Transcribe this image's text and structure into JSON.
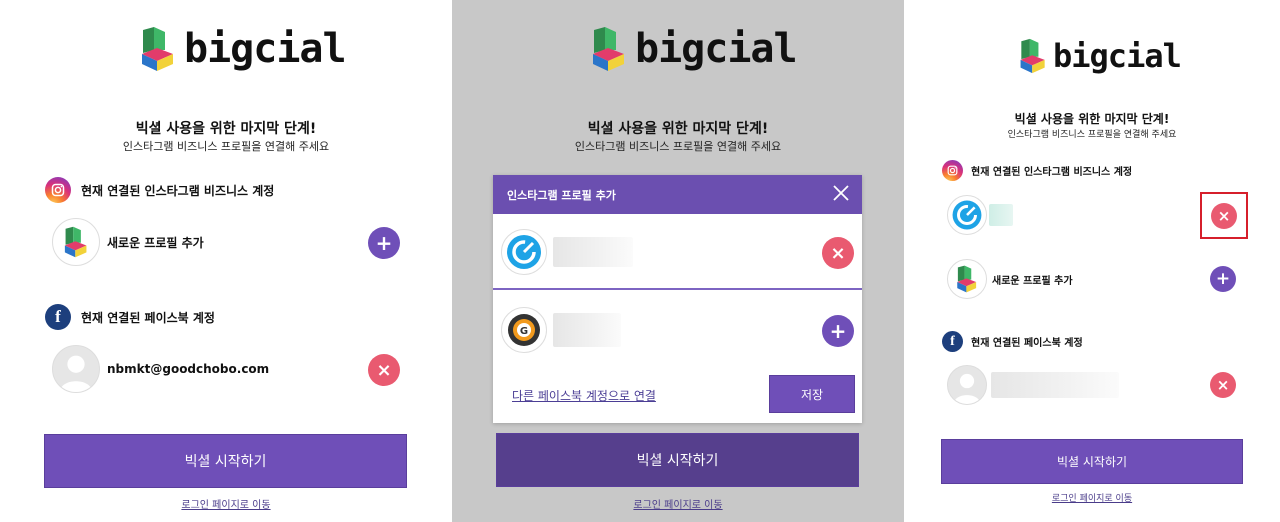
{
  "brand": {
    "name": "bigcial"
  },
  "setup": {
    "heading": "빅셜 사용을 위한 마지막 단계!",
    "subheading": "인스타그램 비즈니스 프로필을 연결해 주세요"
  },
  "instagram_section": {
    "title": "현재 연결된 인스타그램 비즈니스 계정"
  },
  "facebook_section": {
    "title": "현재 연결된 페이스북 계정"
  },
  "add_profile_label": "새로운 프로필 추가",
  "facebook_account_email": "nbmkt@goodchobo.com",
  "start_button": "빅셜 시작하기",
  "login_link": "로그인 페이지로 이동",
  "modal": {
    "title": "인스타그램 프로필 추가",
    "other_facebook_link": "다른 페이스북 계정으로 연결",
    "save_button": "저장"
  },
  "icons": {
    "plus": "plus-icon",
    "close": "close-icon",
    "instagram": "instagram-icon",
    "facebook": "facebook-icon"
  },
  "colors": {
    "primary": "#6f4fb8",
    "danger": "#e95a70",
    "highlight": "#d61f2b",
    "facebook": "#1d3f7d"
  }
}
